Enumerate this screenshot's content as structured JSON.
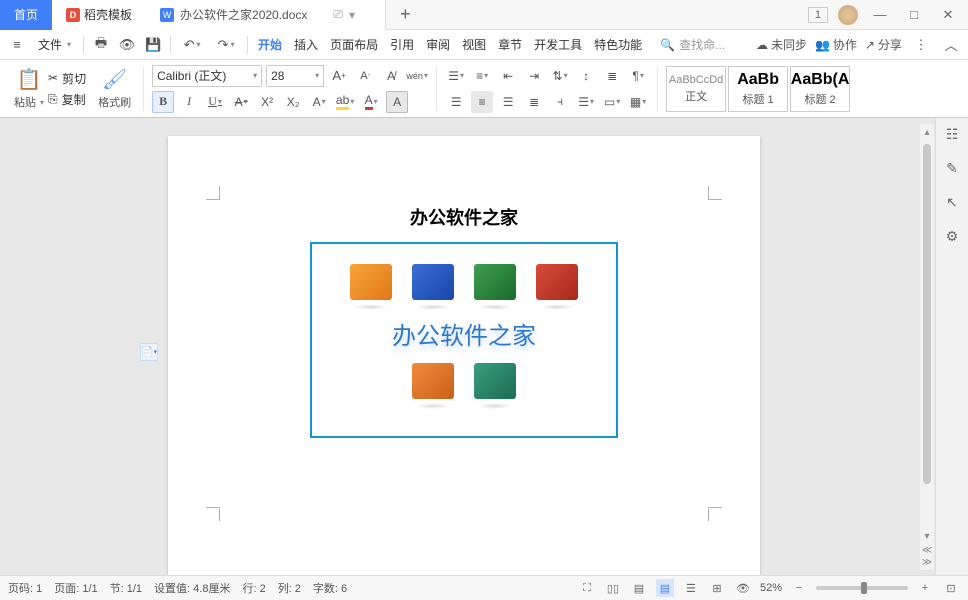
{
  "titlebar": {
    "home": "首页",
    "daoke": "稻壳模板",
    "doc_name": "办公软件之家2020.docx",
    "page_indicator": "1"
  },
  "menubar": {
    "file": "文件",
    "tabs": {
      "start": "开始",
      "insert": "插入",
      "layout": "页面布局",
      "ref": "引用",
      "review": "审阅",
      "view": "视图",
      "chapter": "章节",
      "dev": "开发工具",
      "special": "特色功能"
    },
    "search_placeholder": "查找命...",
    "unsync": "未同步",
    "collab": "协作",
    "share": "分享"
  },
  "ribbon": {
    "paste": "粘贴",
    "cut": "剪切",
    "copy": "复制",
    "format_painter": "格式刷",
    "font": "Calibri (正文)",
    "font_size": "28",
    "styles": {
      "body": {
        "preview": "AaBbCcDd",
        "label": "正文"
      },
      "h1": {
        "preview": "AaBb",
        "label": "标题 1"
      },
      "h2": {
        "preview": "AaBb(A",
        "label": "标题 2"
      }
    }
  },
  "document": {
    "title": "办公软件之家",
    "image_text": "办公软件之家"
  },
  "statusbar": {
    "page_no": "页码: 1",
    "page": "页面: 1/1",
    "section": "节: 1/1",
    "position": "设置值: 4.8厘米",
    "line": "行: 2",
    "col": "列: 2",
    "chars": "字数: 6",
    "zoom": "52%"
  }
}
